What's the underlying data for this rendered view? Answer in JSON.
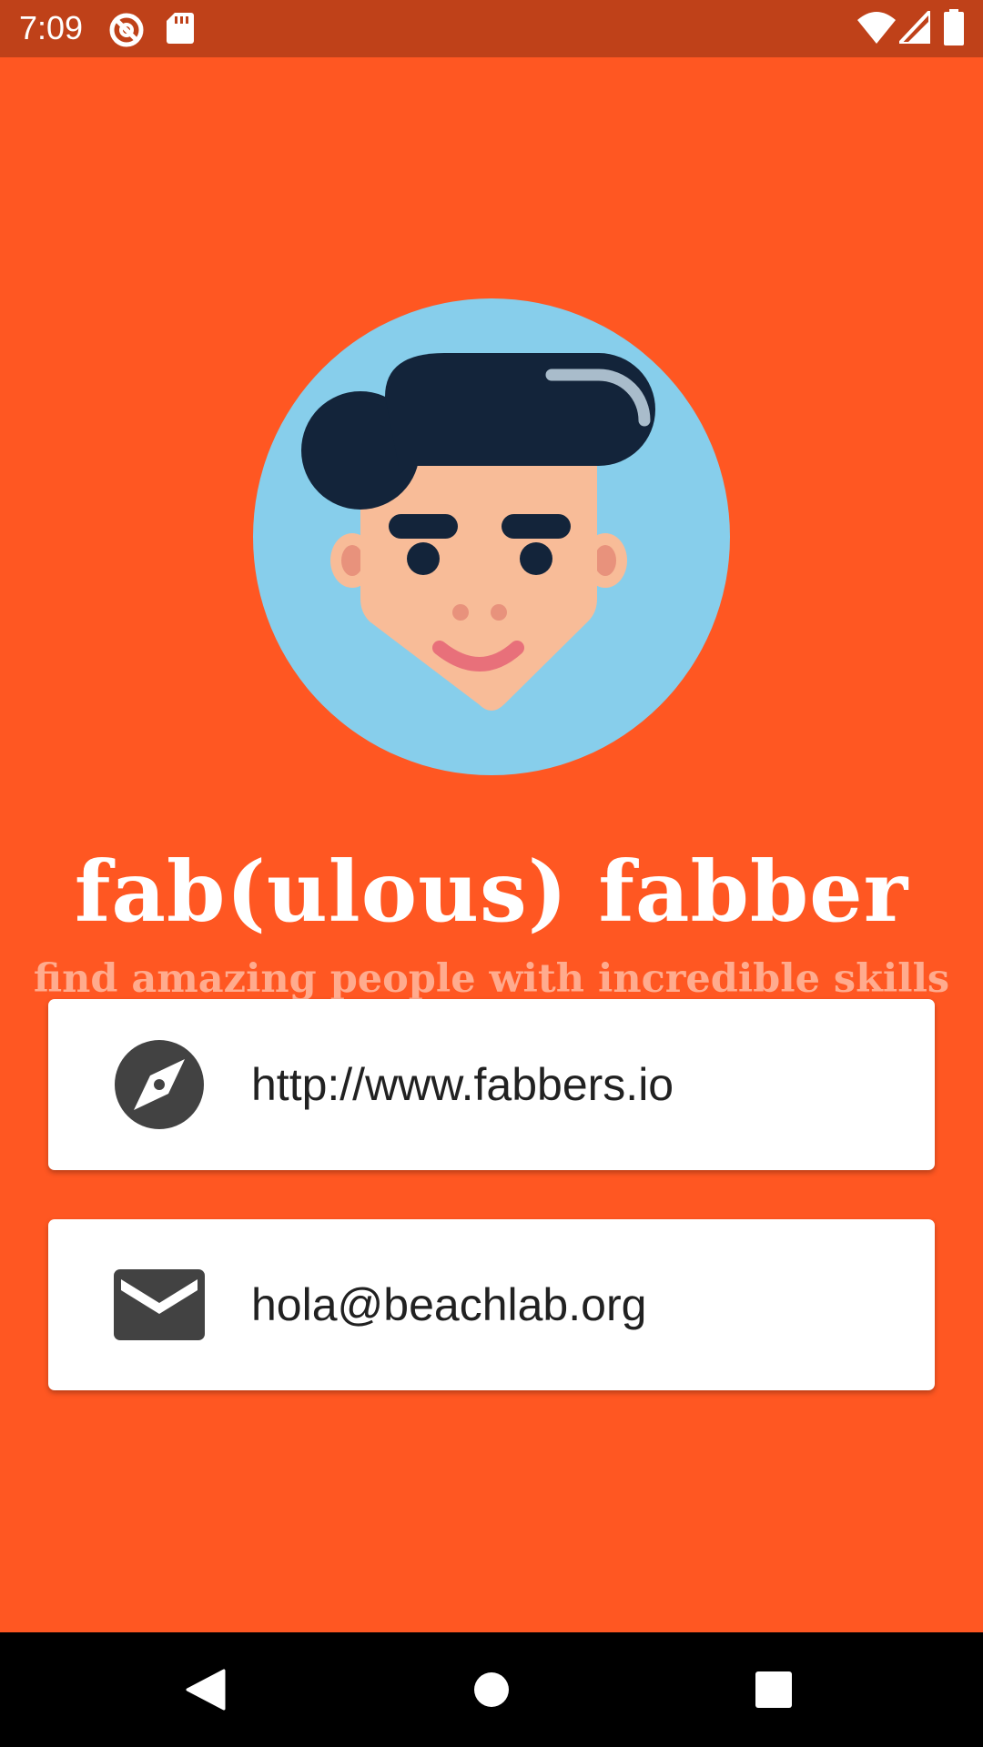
{
  "status_bar": {
    "time": "7:09",
    "icons": [
      "vpn-key-icon",
      "sd-card-icon",
      "wifi-icon",
      "cell-signal-icon",
      "battery-icon"
    ],
    "background": "#BF4119"
  },
  "app": {
    "background": "#FF5722",
    "title": "fab(ulous) fabber",
    "subtitle": "find amazing people with incredible skills",
    "avatar_icon": "avatar-illustration",
    "links": [
      {
        "icon": "compass-icon",
        "text": "http://www.fabbers.io"
      },
      {
        "icon": "mail-icon",
        "text": "hola@beachlab.org"
      }
    ]
  },
  "nav_bar": {
    "buttons": [
      "back-icon",
      "home-icon",
      "recents-icon"
    ]
  },
  "colors": {
    "accent": "#FF5722",
    "subtitle": "#FFAB8E",
    "card": "#FFFFFF",
    "icon": "#424242",
    "avatar_bg": "#87CEEB",
    "hair": "#13243A",
    "skin": "#F8BC98"
  }
}
